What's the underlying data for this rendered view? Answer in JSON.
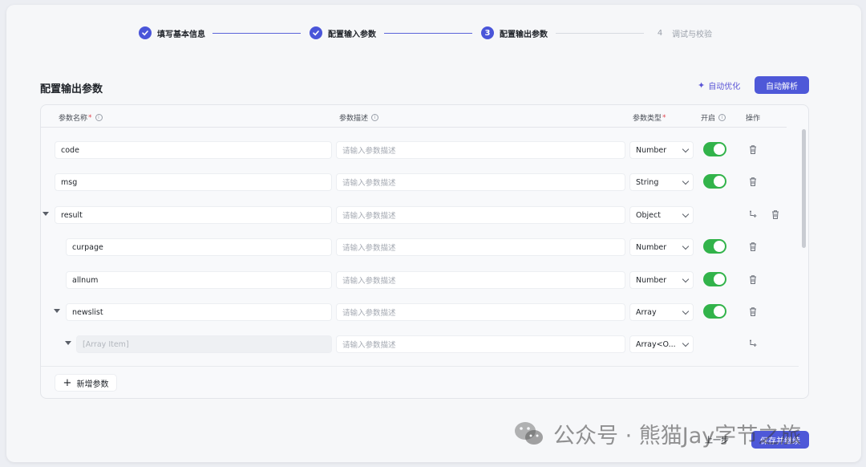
{
  "stepper": {
    "steps": [
      {
        "number": "1",
        "label": "填写基本信息",
        "state": "done"
      },
      {
        "number": "2",
        "label": "配置输入参数",
        "state": "done"
      },
      {
        "number": "3",
        "label": "配置输出参数",
        "state": "active"
      },
      {
        "number": "4",
        "label": "调试与校验",
        "state": "pending"
      }
    ]
  },
  "section": {
    "title": "配置输出参数",
    "optimize_label": "自动优化",
    "parse_label": "自动解析"
  },
  "table": {
    "headers": {
      "name": "参数名称",
      "desc": "参数描述",
      "type": "参数类型",
      "enabled": "开启",
      "ops": "操作",
      "required_mark": "*"
    },
    "rows": [
      {
        "name": "code",
        "desc_placeholder": "请输入参数描述",
        "type": "Number",
        "enabled": true
      },
      {
        "name": "msg",
        "desc_placeholder": "请输入参数描述",
        "type": "String",
        "enabled": true
      },
      {
        "name": "result",
        "desc_placeholder": "请输入参数描述",
        "type": "Object",
        "enabled": null
      },
      {
        "name": "curpage",
        "desc_placeholder": "请输入参数描述",
        "type": "Number",
        "enabled": true
      },
      {
        "name": "allnum",
        "desc_placeholder": "请输入参数描述",
        "type": "Number",
        "enabled": true
      },
      {
        "name": "newslist",
        "desc_placeholder": "请输入参数描述",
        "type": "Array",
        "enabled": true
      },
      {
        "name": "[Array Item]",
        "desc_placeholder": "请输入参数描述",
        "type": "Array<O...",
        "enabled": null
      }
    ],
    "add_label": "新增参数"
  },
  "footer": {
    "prev_label": "上一步",
    "save_label": "保存并继续"
  },
  "watermark": {
    "text": "公众号 · 熊猫Jay字节之旅"
  },
  "colors": {
    "accent": "#4e58d8",
    "toggle_on": "#32b34a",
    "required": "#e0454e"
  }
}
